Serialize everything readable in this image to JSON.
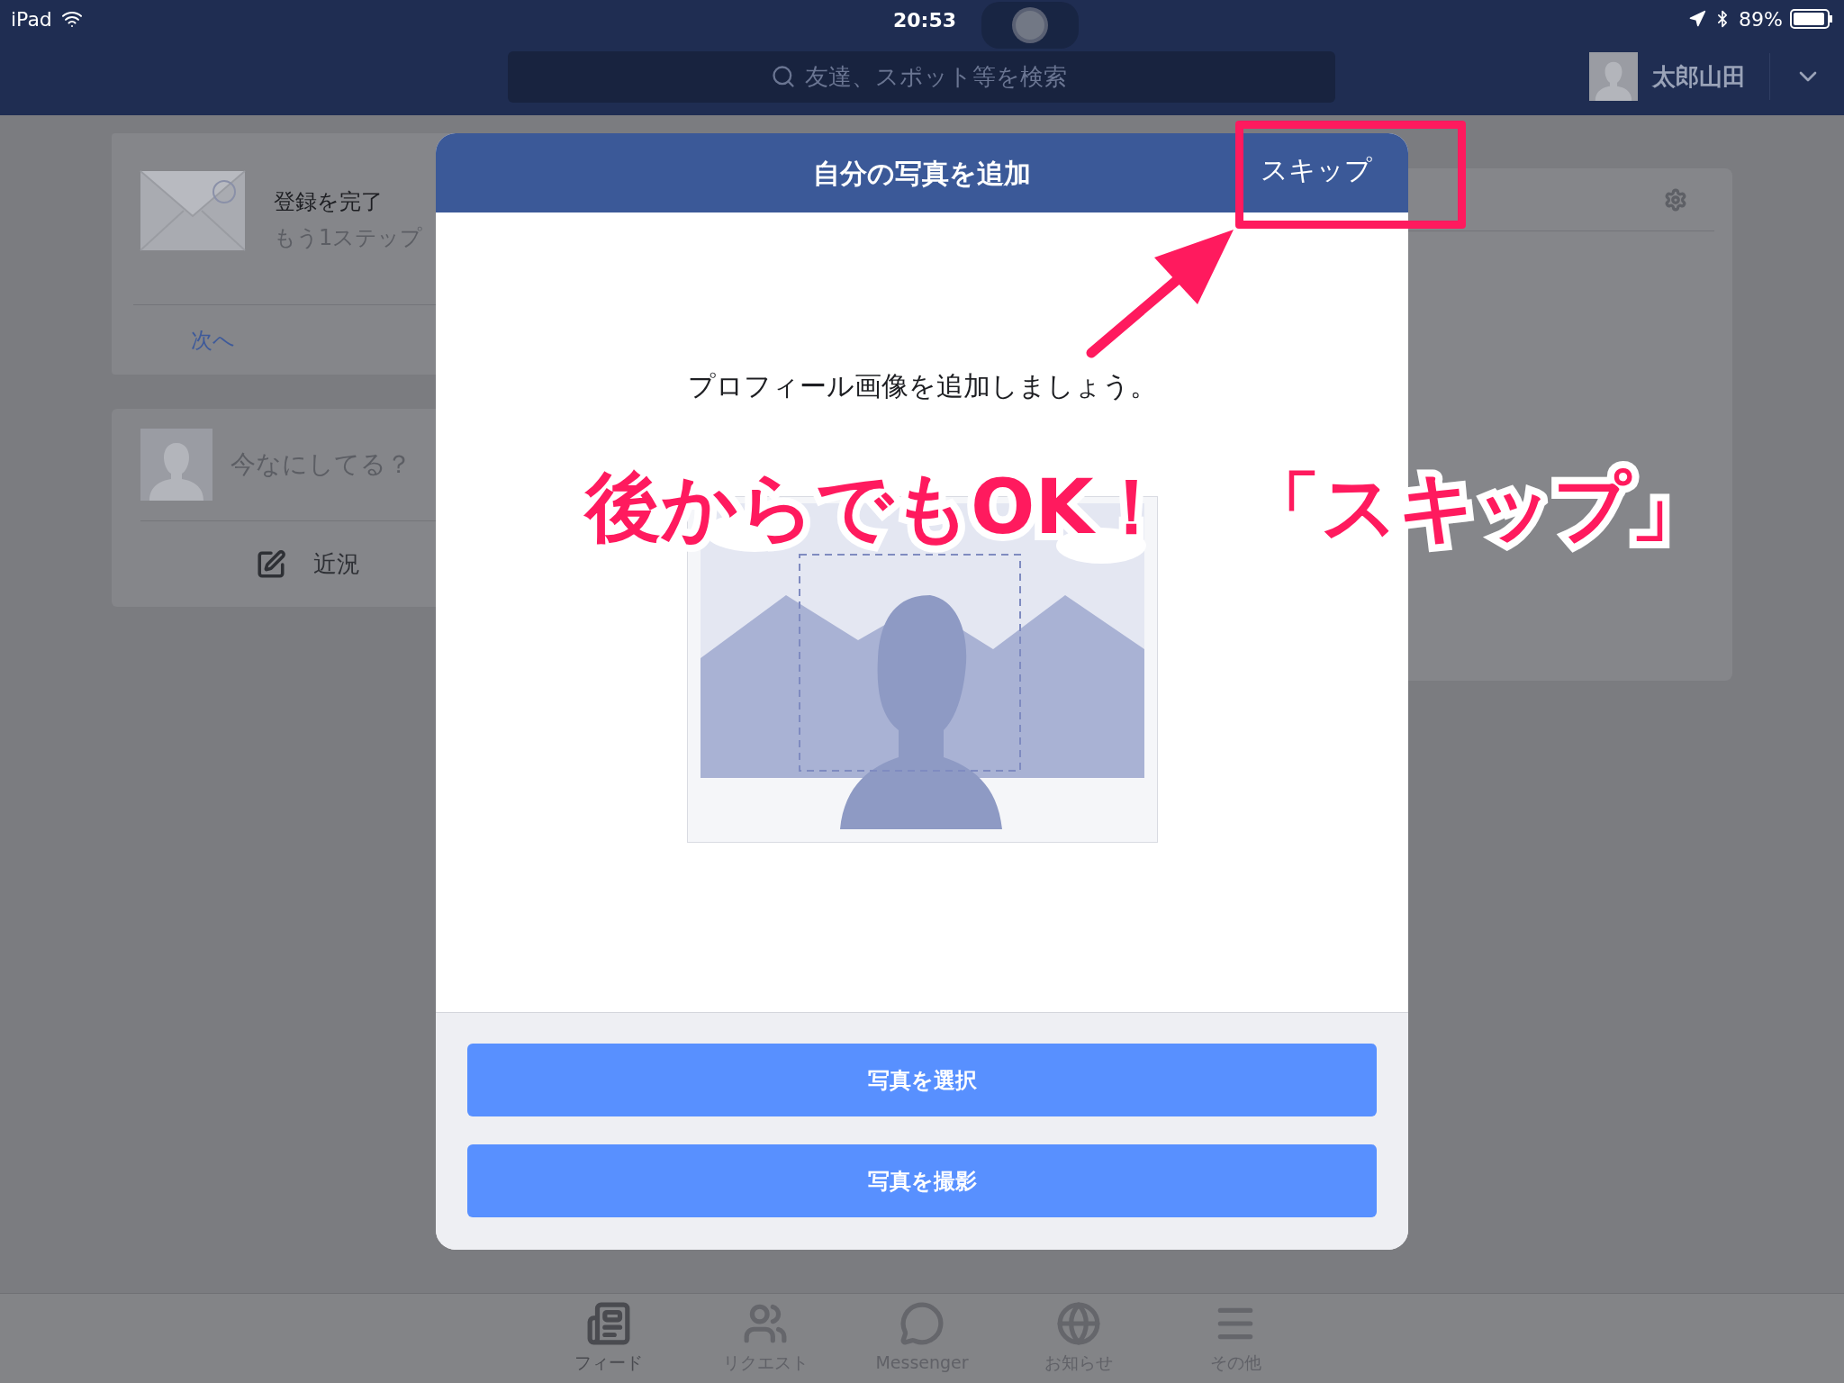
{
  "status_bar": {
    "device": "iPad",
    "time": "20:53",
    "battery": "89%"
  },
  "nav_bar": {
    "search": {
      "placeholder": "友達、スポット等を検索"
    },
    "user_name": "太郎山田"
  },
  "feed_cards": [
    {
      "kind": "registration",
      "title": "登録を完了",
      "subtitle": "もう1ステップ",
      "action": "次へ"
    },
    {
      "kind": "composer",
      "placeholder": "今なにしてる？",
      "action": "近況"
    }
  ],
  "dialog": {
    "title": "自分の写真を追加",
    "skip": "スキップ",
    "message": "プロフィール画像を追加しましょう。",
    "buttons": [
      "写真を選択",
      "写真を撮影"
    ]
  },
  "annotation": {
    "text": "後からでもOK！　「スキップ」"
  },
  "tab_bar": [
    {
      "label": "フィード",
      "selected": true
    },
    {
      "label": "リクエスト",
      "selected": false
    },
    {
      "label": "Messenger",
      "selected": false
    },
    {
      "label": "お知らせ",
      "selected": false
    },
    {
      "label": "その他",
      "selected": false
    }
  ]
}
